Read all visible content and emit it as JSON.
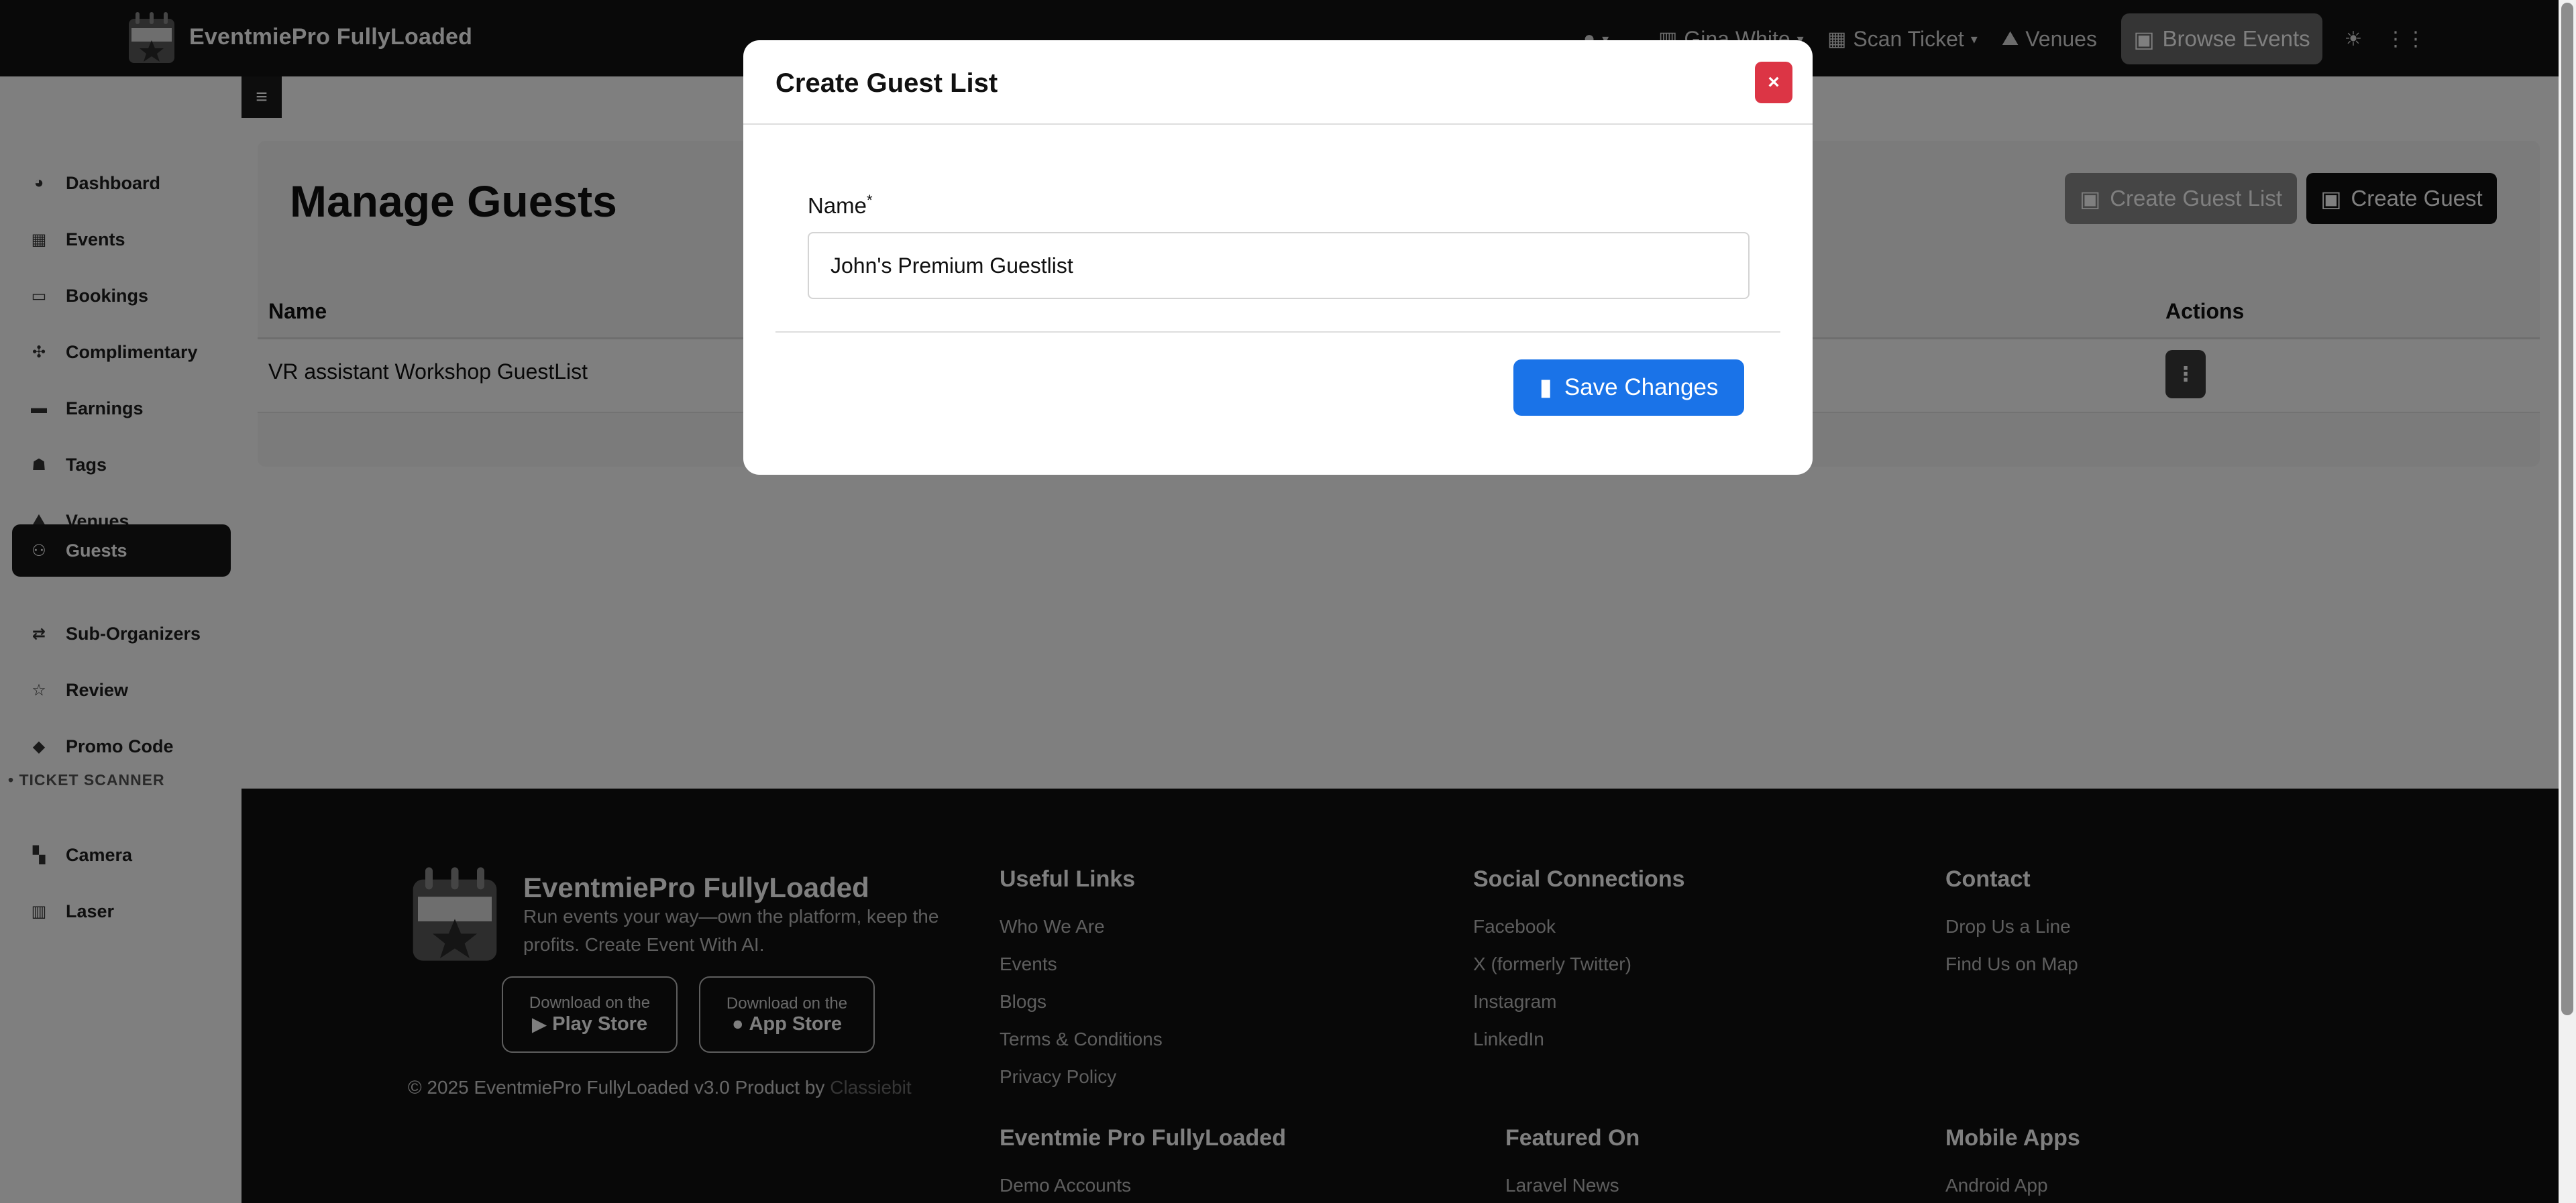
{
  "topbar": {
    "brand": "EventmiePro FullyLoaded",
    "user_name": "Gina White",
    "scan_ticket": "Scan Ticket",
    "venues": "Venues",
    "browse_events": "Browse Events"
  },
  "sidebar": {
    "items": [
      {
        "label": "Dashboard",
        "icon": "gauge-icon"
      },
      {
        "label": "Events",
        "icon": "calendar-icon"
      },
      {
        "label": "Bookings",
        "icon": "ticket-icon"
      },
      {
        "label": "Complimentary",
        "icon": "puzzle-icon"
      },
      {
        "label": "Earnings",
        "icon": "wallet-icon"
      },
      {
        "label": "Tags",
        "icon": "user-tag-icon"
      },
      {
        "label": "Venues",
        "icon": "map-icon"
      },
      {
        "label": "Guests",
        "icon": "users-icon"
      },
      {
        "label": "Sub-Organizers",
        "icon": "people-arrows-icon"
      },
      {
        "label": "Review",
        "icon": "star-icon"
      },
      {
        "label": "Promo Code",
        "icon": "tag-icon"
      }
    ],
    "section_title": "TICKET SCANNER",
    "scanner_items": [
      {
        "label": "Camera",
        "icon": "grid-icon"
      },
      {
        "label": "Laser",
        "icon": "barcode-icon"
      }
    ]
  },
  "main": {
    "title": "Manage Guests",
    "create_guest_list": "Create Guest List",
    "create_guest": "Create Guest",
    "table": {
      "col_name": "Name",
      "col_actions": "Actions",
      "rows": [
        {
          "name": "VR assistant Workshop GuestList"
        }
      ]
    }
  },
  "modal": {
    "title": "Create Guest List",
    "close": "×",
    "name_label": "Name",
    "required_mark": "*",
    "name_value": "John's Premium Guestlist",
    "save": "Save Changes"
  },
  "footer": {
    "brand": "EventmiePro FullyLoaded",
    "tagline": "Run events your way—own the platform, keep the profits. Create Event With AI.",
    "play_small": "Download on the",
    "play_big": "Play Store",
    "app_small": "Download on the",
    "app_big": "App Store",
    "copyright": "© 2025 EventmiePro FullyLoaded v3.0 Product by",
    "copyright_link": "Classiebit",
    "useful_links_title": "Useful Links",
    "useful_links": [
      "Who We Are",
      "Events",
      "Blogs",
      "Terms & Conditions",
      "Privacy Policy"
    ],
    "social_title": "Social Connections",
    "social_links": [
      "Facebook",
      "X (formerly Twitter)",
      "Instagram",
      "LinkedIn"
    ],
    "contact_title": "Contact",
    "contact_links": [
      "Drop Us a Line",
      "Find Us on Map"
    ],
    "eventmie_title": "Eventmie Pro FullyLoaded",
    "eventmie_links": [
      "Demo Accounts"
    ],
    "featured_title": "Featured On",
    "featured_links": [
      "Laravel News"
    ],
    "mobile_title": "Mobile Apps",
    "mobile_links": [
      "Android App"
    ]
  }
}
